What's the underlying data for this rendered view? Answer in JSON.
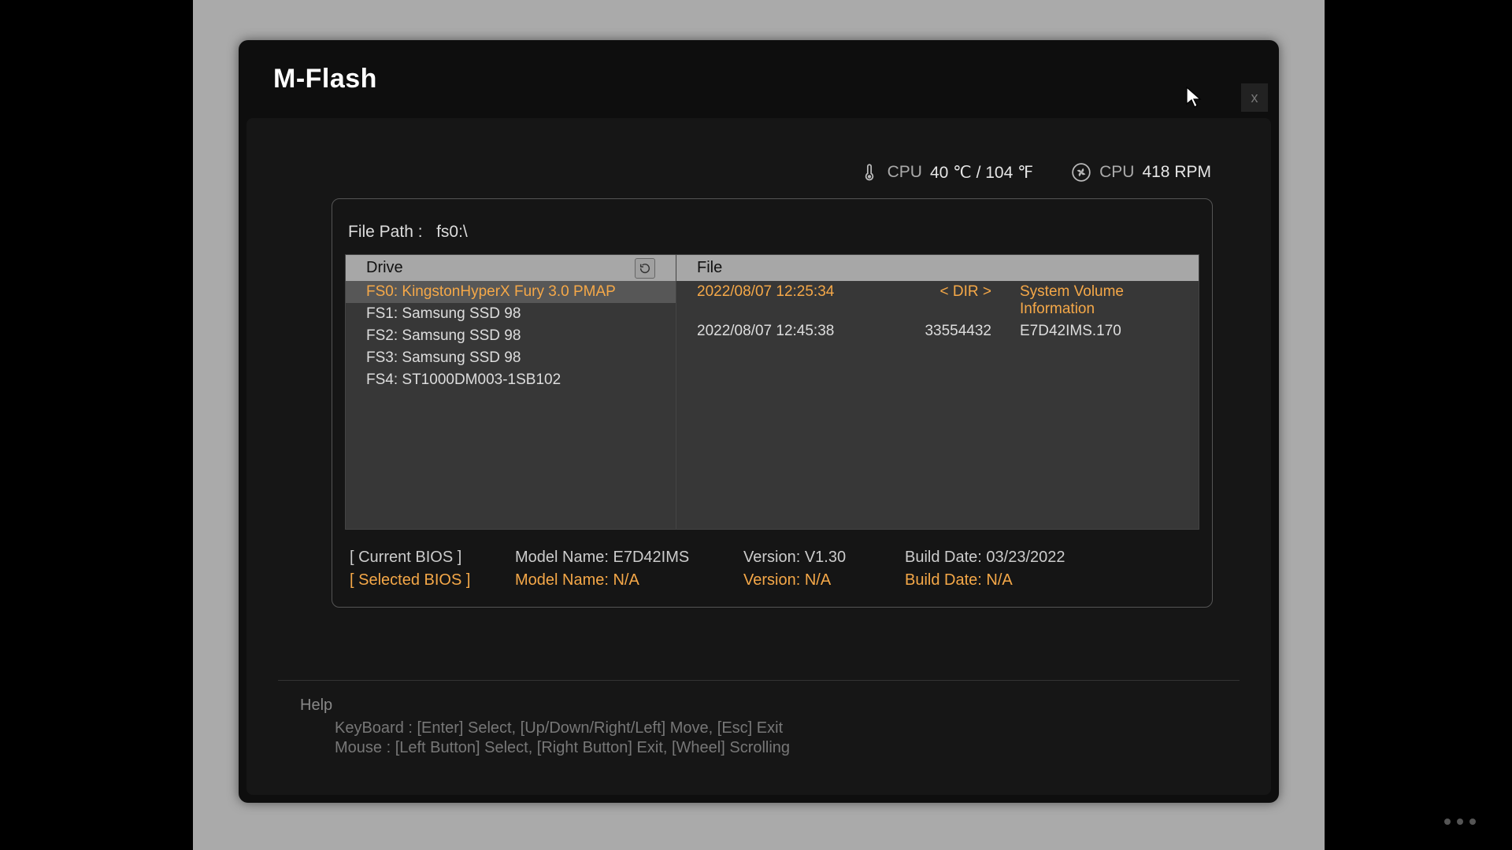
{
  "title": "M-Flash",
  "close_label": "x",
  "status": {
    "cpu_temp_label": "CPU",
    "cpu_temp_value": "40 ℃ / 104 ℉",
    "cpu_fan_label": "CPU",
    "cpu_fan_value": "418 RPM"
  },
  "file_path": {
    "label": "File Path :",
    "value": "fs0:\\"
  },
  "drive_header": "Drive",
  "file_header": "File",
  "drives": [
    {
      "label": "FS0: KingstonHyperX Fury 3.0 PMAP",
      "selected": true
    },
    {
      "label": "FS1: Samsung SSD 98",
      "selected": false
    },
    {
      "label": "FS2: Samsung SSD 98",
      "selected": false
    },
    {
      "label": "FS3: Samsung SSD 98",
      "selected": false
    },
    {
      "label": "FS4: ST1000DM003-1SB102",
      "selected": false
    }
  ],
  "files": [
    {
      "date": "2022/08/07 12:25:34",
      "size": "< DIR >",
      "name": "System Volume Information",
      "selected": true
    },
    {
      "date": "2022/08/07 12:45:38",
      "size": "33554432",
      "name": "E7D42IMS.170",
      "selected": false
    }
  ],
  "bios": {
    "current_label": "[ Current BIOS  ]",
    "selected_label": "[ Selected BIOS ]",
    "current": {
      "model": "Model Name: E7D42IMS",
      "version": "Version: V1.30",
      "build": "Build Date: 03/23/2022"
    },
    "selected": {
      "model": "Model Name: N/A",
      "version": "Version: N/A",
      "build": "Build Date: N/A"
    }
  },
  "help": {
    "title": "Help",
    "keyboard": "KeyBoard :   [Enter]  Select,    [Up/Down/Right/Left]  Move,    [Esc]  Exit",
    "mouse": "Mouse      :   [Left Button]  Select,    [Right Button]  Exit,    [Wheel]  Scrolling"
  }
}
